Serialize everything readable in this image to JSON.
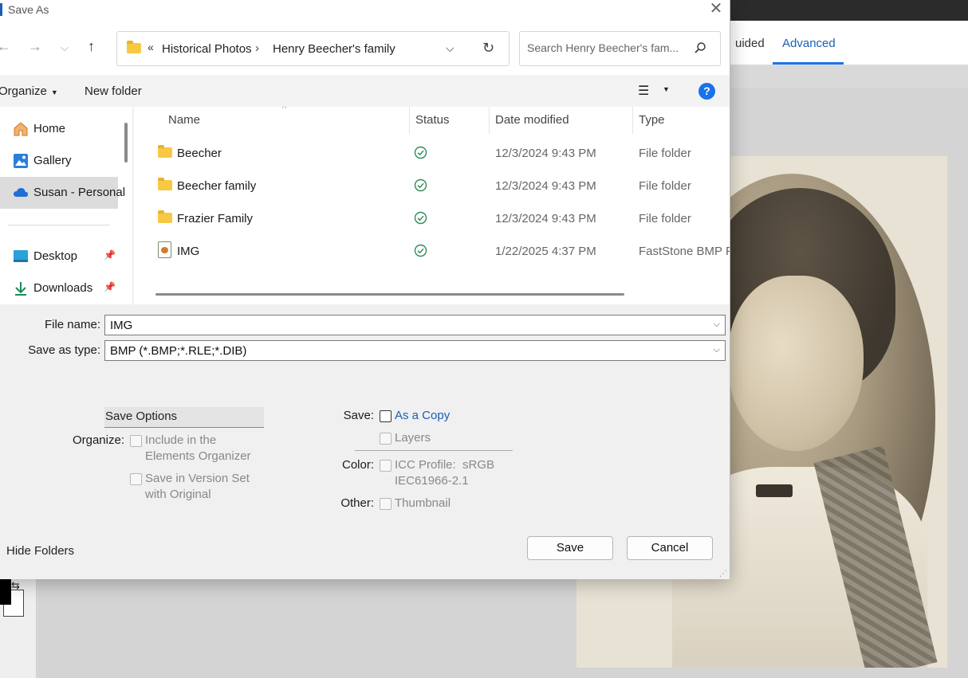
{
  "background_app": {
    "tabs": [
      "uided",
      "Advanced"
    ],
    "active_tab": "Advanced"
  },
  "dialog": {
    "title": "Save As",
    "nav": {
      "breadcrumb_prefix": "«",
      "breadcrumbs": [
        "Historical Photos",
        "Henry Beecher's family"
      ],
      "separator": "›",
      "search_placeholder": "Search Henry Beecher's fam..."
    },
    "toolbar": {
      "organize_label": "Organize",
      "new_folder_label": "New folder",
      "help_label": "?"
    },
    "navpane": {
      "items": [
        {
          "label": "Home",
          "icon": "home-icon"
        },
        {
          "label": "Gallery",
          "icon": "gallery-icon"
        },
        {
          "label": "Susan - Personal",
          "icon": "onedrive-cloud-icon",
          "selected": true
        },
        {
          "label": "Desktop",
          "icon": "desktop-icon",
          "pinned": true
        },
        {
          "label": "Downloads",
          "icon": "download-icon",
          "pinned": true
        }
      ]
    },
    "files": {
      "columns": [
        "Name",
        "Status",
        "Date modified",
        "Type"
      ],
      "rows": [
        {
          "name": "Beecher",
          "icon": "folder-icon",
          "date": "12/3/2024 9:43 PM",
          "type": "File folder"
        },
        {
          "name": "Beecher family",
          "icon": "folder-icon",
          "date": "12/3/2024 9:43 PM",
          "type": "File folder"
        },
        {
          "name": "Frazier Family",
          "icon": "folder-icon",
          "date": "12/3/2024 9:43 PM",
          "type": "File folder"
        },
        {
          "name": "IMG",
          "icon": "image-file-icon",
          "date": "1/22/2025 4:37 PM",
          "type": "FastStone BMP Fil"
        }
      ]
    },
    "form": {
      "file_name_label": "File name:",
      "file_name_value": "IMG",
      "save_as_type_label": "Save as type:",
      "save_as_type_value": "BMP (*.BMP;*.RLE;*.DIB)"
    },
    "options": {
      "heading": "Save Options",
      "organize_label": "Organize:",
      "include_organizer": "Include in the\nElements Organizer",
      "include_organizer_l1": "Include in the",
      "include_organizer_l2": "Elements Organizer",
      "version_set_l1": "Save in Version Set",
      "version_set_l2": "with Original",
      "save_label": "Save:",
      "as_a_copy": "As a Copy",
      "layers": "Layers",
      "color_label": "Color:",
      "icc_l1": "ICC Profile:  sRGB",
      "icc_l2": "IEC61966-2.1",
      "other_label": "Other:",
      "thumbnail": "Thumbnail"
    },
    "footer": {
      "hide_folders": "Hide Folders",
      "save_button": "Save",
      "cancel_button": "Cancel"
    }
  },
  "colors": {
    "accent": "#1a73e8",
    "link": "#1a5fb4",
    "sync_ok": "#2e8b57",
    "folder": "#f7c843"
  }
}
